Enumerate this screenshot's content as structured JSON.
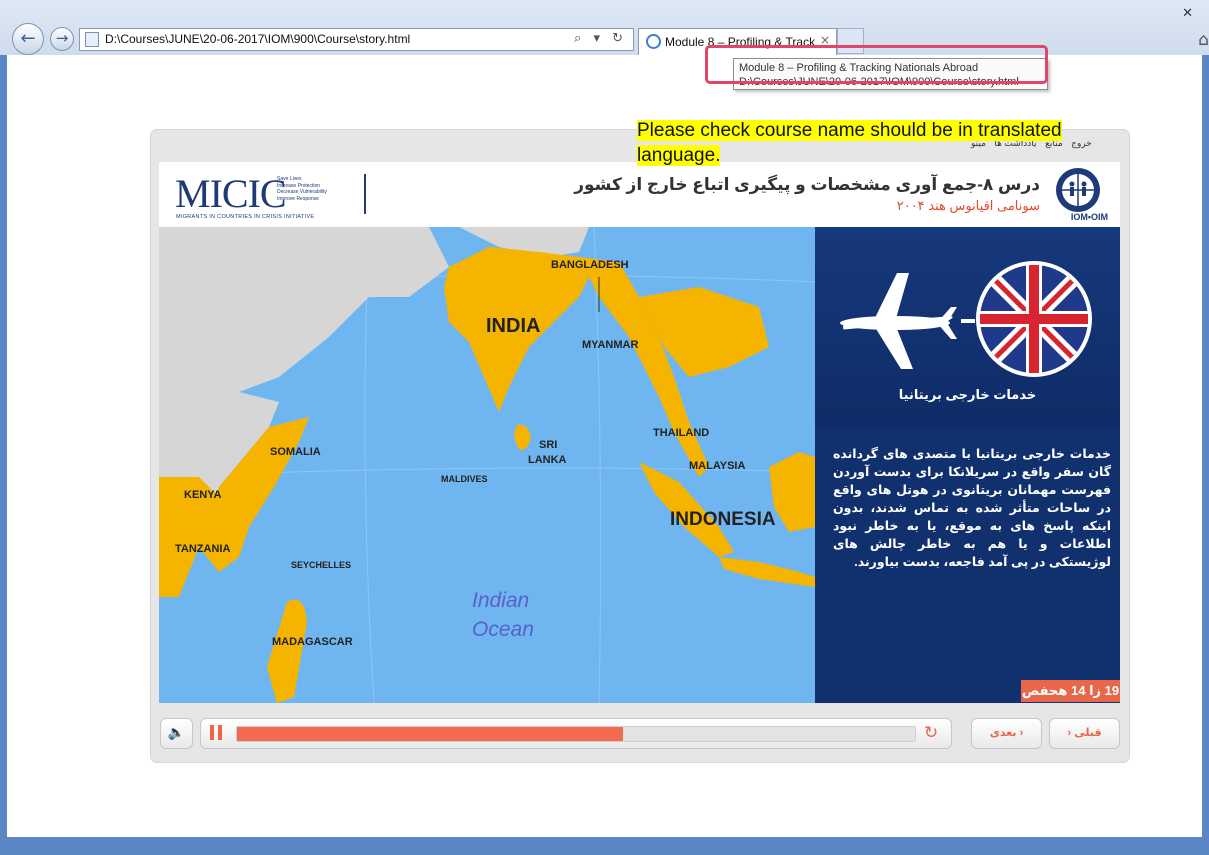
{
  "browser": {
    "address": "D:\\Courses\\JUNE\\20-06-2017\\IOM\\900\\Course\\story.html",
    "address_tools": "⌕ ▾ ↻",
    "tab_title": "Module 8 – Profiling & Tracking Nationals Abroad",
    "tab_close": "×",
    "window_close": "✕",
    "home_icon": "⌂",
    "back_glyph": "←",
    "forward_glyph": "→"
  },
  "tooltip": {
    "line1": "Module 8 – Profiling & Tracking Nationals Abroad",
    "line2": "D:\\Courses\\JUNE\\20-06-2017\\IOM\\900\\Course\\story.html"
  },
  "annotation": {
    "text": "Please check course name should be in translated language."
  },
  "player": {
    "menu": {
      "exit": "خروج",
      "resources": "منابع",
      "notes": "یادداشت ها",
      "menu": "مینو"
    },
    "header": {
      "micic": "MICIC",
      "micic_taglines": [
        "Save Lives",
        "Increase Protection",
        "Decrease Vulnerability",
        "Improve Response"
      ],
      "micic_subtitle": "MIGRANTS IN COUNTRIES IN CRISIS INITIATIVE",
      "lesson_title": "درس ۸-جمع آوری مشخصات و پیگیری اتباع خارج از کشور",
      "lesson_subtitle": "سونامی اقیانوس هند ۲۰۰۴",
      "iom_label": "IOM•OIM"
    },
    "map_labels": {
      "bangladesh": "BANGLADESH",
      "india": "INDIA",
      "myanmar": "MYANMAR",
      "somalia": "SOMALIA",
      "sri_lanka_1": "SRI",
      "sri_lanka_2": "LANKA",
      "thailand": "THAILAND",
      "malaysia": "MALAYSIA",
      "maldives": "MALDIVES",
      "kenya": "KENYA",
      "indonesia": "INDONESIA",
      "tanzania": "TANZANIA",
      "seychelles": "SEYCHELLES",
      "ocean_1": "Indian",
      "ocean_2": "Ocean",
      "madagascar": "MADAGASCAR"
    },
    "panel": {
      "caption": "خدمات خارجی بریتانیا",
      "body": "خدمات خارجی بریتانیا با متصدی های گردانده گان سفر واقع در سریلانکا برای بدست آوردن فهرست مهمانان بریتانوی در هوتل های واقع در ساحات متأثر شده به تماس شدند، بدون اینکه پاسخ های به موقع، یا به خاطر نبود اطلاعات و یا هم به خاطر چالش های لوژیستکی در پی آمد فاجعه، بدست بیاورند.",
      "slide_counter": "19 زا 14 هحفص"
    },
    "controls": {
      "volume_icon": "🔈",
      "replay_icon": "↻",
      "progress": 0.57,
      "next_label": "بعدی ›",
      "prev_label": "› قبلی"
    }
  }
}
